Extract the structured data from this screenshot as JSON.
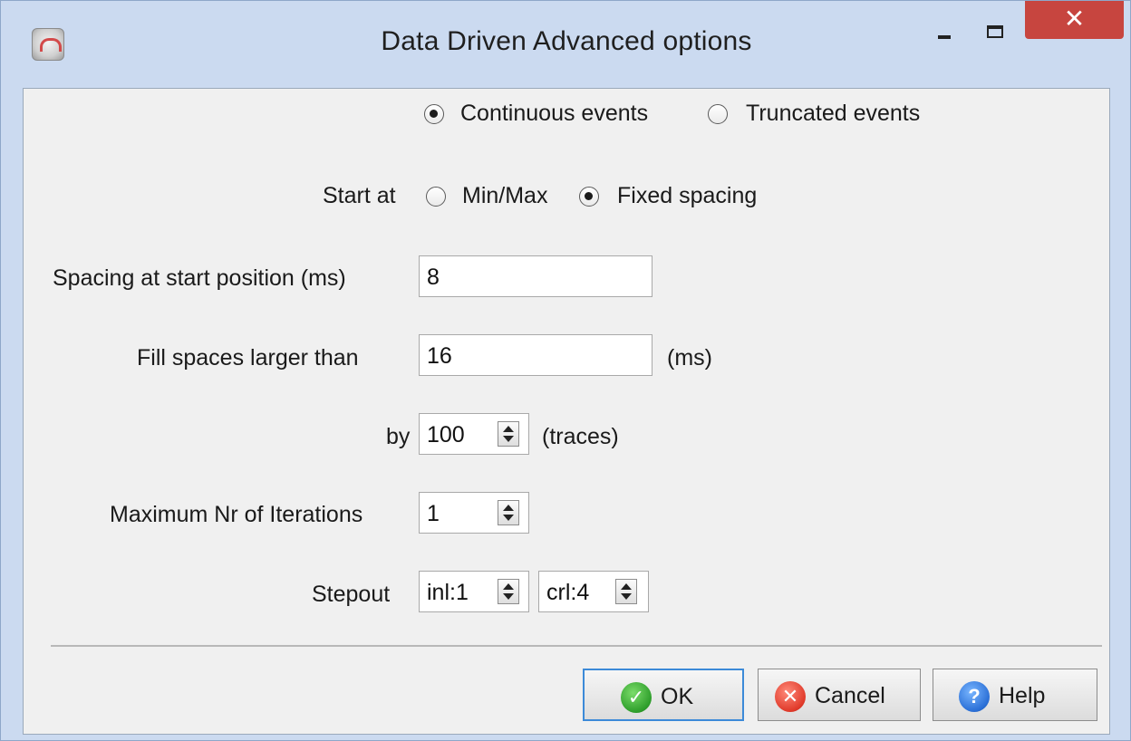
{
  "window": {
    "title": "Data Driven Advanced options",
    "close_glyph": "✕",
    "title_icons": [
      "app-icon",
      "minimize-icon",
      "maximize-icon",
      "close-icon"
    ]
  },
  "event_mode": {
    "options": [
      {
        "label": "Continuous events",
        "checked": true
      },
      {
        "label": "Truncated events",
        "checked": false
      }
    ]
  },
  "start_at": {
    "label": "Start at",
    "options": [
      {
        "label": "Min/Max",
        "checked": false
      },
      {
        "label": "Fixed spacing",
        "checked": true
      }
    ]
  },
  "spacing": {
    "label": "Spacing at start position (ms)",
    "value": "8"
  },
  "fill": {
    "label": "Fill spaces larger than",
    "value": "16",
    "unit": "(ms)"
  },
  "by": {
    "label": "by",
    "value": "100",
    "unit": "(traces)"
  },
  "iterations": {
    "label": "Maximum Nr of Iterations",
    "value": "1"
  },
  "stepout": {
    "label": "Stepout",
    "inl": "inl:1",
    "crl": "crl:4"
  },
  "buttons": {
    "ok": "OK",
    "cancel": "Cancel",
    "help": "Help",
    "ok_glyph": "✓",
    "cancel_glyph": "✕",
    "help_glyph": "?"
  },
  "colors": {
    "close": "#c7453f",
    "default_button_border": "#3c8ad8",
    "ok_icon": "#2e9e2b",
    "cancel_icon": "#e03a2a",
    "help_icon": "#2a6fd6"
  }
}
